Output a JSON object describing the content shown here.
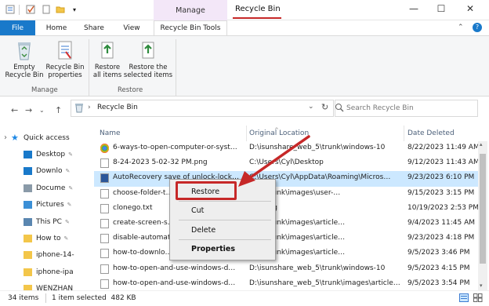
{
  "window": {
    "title": "Recycle Bin",
    "contextual_tab": "Manage"
  },
  "quick_access_toolbar": {
    "items": [
      "properties-icon",
      "checkmark-icon",
      "blank-page-icon",
      "folder-icon",
      "customize-icon"
    ]
  },
  "window_controls": {
    "minimize": "—",
    "maximize": "☐",
    "close": "✕"
  },
  "ribbon_tabs": [
    "File",
    "Home",
    "Share",
    "View",
    "Recycle Bin Tools"
  ],
  "ribbon": {
    "groups": [
      {
        "name": "Manage",
        "buttons": [
          {
            "label": "Empty\nRecycle Bin"
          },
          {
            "label": "Recycle Bin\nproperties"
          }
        ]
      },
      {
        "name": "Restore",
        "buttons": [
          {
            "label": "Restore\nall items"
          },
          {
            "label": "Restore the\nselected items"
          }
        ]
      }
    ]
  },
  "address": {
    "path": "Recycle Bin",
    "search_placeholder": "Search Recycle Bin"
  },
  "nav_pane": {
    "items": [
      {
        "label": "Quick access",
        "icon": "star-icon",
        "pinned": false
      },
      {
        "label": "Desktop",
        "icon": "desktop-icon",
        "pinned": true
      },
      {
        "label": "Downlo",
        "icon": "download-icon",
        "pinned": true
      },
      {
        "label": "Docume",
        "icon": "documents-icon",
        "pinned": true
      },
      {
        "label": "Pictures",
        "icon": "pictures-icon",
        "pinned": true
      },
      {
        "label": "This PC",
        "icon": "this-pc-icon",
        "pinned": true
      },
      {
        "label": "How to",
        "icon": "folder-icon",
        "pinned": true
      },
      {
        "label": "iphone-14-",
        "icon": "folder-icon",
        "pinned": false
      },
      {
        "label": "iphone-ipa",
        "icon": "folder-icon",
        "pinned": false
      },
      {
        "label": "WENZHAN",
        "icon": "folder-icon",
        "pinned": false
      }
    ]
  },
  "columns": [
    "Name",
    "Original Location",
    "Date Deleted"
  ],
  "files": [
    {
      "name": "6-ways-to-open-computer-or-syst…",
      "location": "D:\\isunshare_web_5\\trunk\\windows-10",
      "date": "8/22/2023 11:49 AM",
      "icon": "chrome-icon"
    },
    {
      "name": "8-24-2023 5-02-32 PM.png",
      "location": "C:\\Users\\Cyl\\Desktop",
      "date": "9/12/2023 11:43 AM",
      "icon": "image-file-icon"
    },
    {
      "name": "AutoRecovery save of unlock-lock…",
      "location": "C:\\Users\\Cyl\\AppData\\Roaming\\Micros…",
      "date": "9/23/2023 6:10 PM",
      "icon": "word-doc-icon"
    },
    {
      "name": "choose-folder-t…",
      "location": "…_5\\trunk\\images\\user-…",
      "date": "9/15/2023 3:15 PM",
      "icon": "file-icon"
    },
    {
      "name": "clonego.txt",
      "location": "…_5\\log",
      "date": "10/19/2023 2:53 PM",
      "icon": "text-file-icon"
    },
    {
      "name": "create-screen-s…",
      "location": "…_5\\trunk\\images\\article…",
      "date": "9/4/2023 11:45 AM",
      "icon": "file-icon"
    },
    {
      "name": "disable-automat…",
      "location": "…_5\\trunk\\images\\article…",
      "date": "9/23/2023 4:18 PM",
      "icon": "file-icon"
    },
    {
      "name": "how-to-downlo…",
      "location": "…_5\\trunk\\images\\article…",
      "date": "9/5/2023 3:46 PM",
      "icon": "file-icon"
    },
    {
      "name": "how-to-open-and-use-windows-d…",
      "location": "D:\\isunshare_web_5\\trunk\\windows-10",
      "date": "9/5/2023 4:15 PM",
      "icon": "file-icon"
    },
    {
      "name": "how-to-open-and-use-windows-d…",
      "location": "D:\\isunshare_web_5\\trunk\\images\\article…",
      "date": "9/5/2023 3:54 PM",
      "icon": "file-icon"
    }
  ],
  "context_menu": {
    "items": [
      "Restore",
      "Cut",
      "Delete",
      "Properties"
    ]
  },
  "status": {
    "count": "34 items",
    "selection": "1 item selected  482 KB"
  },
  "colors": {
    "accent": "#1979ca",
    "highlight": "#c62828",
    "selection": "#cce8ff",
    "manage_tab": "#f3e7f8"
  }
}
